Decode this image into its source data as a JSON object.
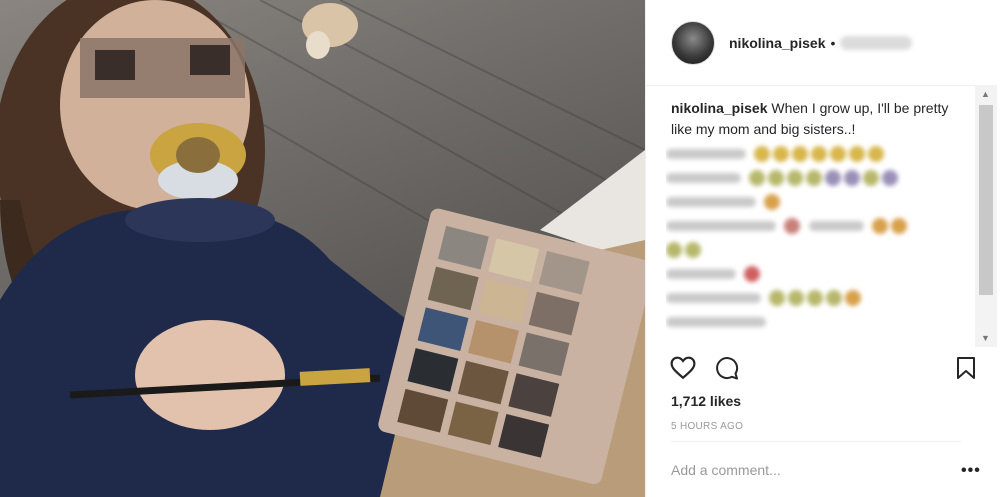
{
  "post": {
    "username": "nikolina_pisek",
    "separator": "•",
    "caption_user": "nikolina_pisek",
    "caption_text": "When I grow up, I'll be pretty like my mom and big sisters..!",
    "likes": "1,712 likes",
    "time": "5 HOURS AGO",
    "add_comment_placeholder": "Add a comment...",
    "more_label": "•••"
  },
  "icons": {
    "like": "heart-icon",
    "comment": "comment-bubble-icon",
    "save": "bookmark-icon"
  },
  "colors": {
    "text": "#262626",
    "muted": "#999999",
    "border": "#efefef"
  }
}
